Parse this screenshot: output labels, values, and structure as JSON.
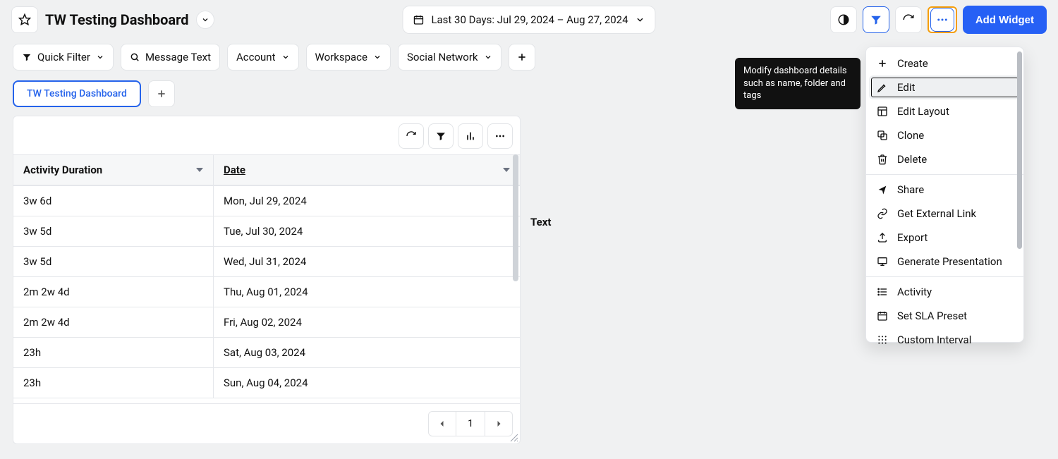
{
  "header": {
    "title": "TW Testing Dashboard",
    "date_label": "Last 30 Days: Jul 29, 2024 – Aug 27, 2024",
    "add_widget_label": "Add Widget"
  },
  "filters": {
    "quick_filter": "Quick Filter",
    "message_text": "Message Text",
    "account": "Account",
    "workspace": "Workspace",
    "social_network": "Social Network"
  },
  "tabs": {
    "active": "TW Testing Dashboard"
  },
  "tooltip": "Modify dashboard details such as name, folder and tags",
  "menu": {
    "create": "Create",
    "edit": "Edit",
    "edit_layout": "Edit Layout",
    "clone": "Clone",
    "delete": "Delete",
    "share": "Share",
    "external_link": "Get External Link",
    "export": "Export",
    "generate_presentation": "Generate Presentation",
    "activity": "Activity",
    "sla_preset": "Set SLA Preset",
    "custom_interval": "Custom Interval"
  },
  "widget": {
    "columns": {
      "activity": "Activity Duration",
      "date": "Date"
    },
    "rows": [
      {
        "activity": "3w 6d",
        "date": "Mon, Jul 29, 2024"
      },
      {
        "activity": "3w 5d",
        "date": "Tue, Jul 30, 2024"
      },
      {
        "activity": "3w 5d",
        "date": "Wed, Jul 31, 2024"
      },
      {
        "activity": "2m 2w 4d",
        "date": "Thu, Aug 01, 2024"
      },
      {
        "activity": "2m 2w 4d",
        "date": "Fri, Aug 02, 2024"
      },
      {
        "activity": "23h",
        "date": "Sat, Aug 03, 2024"
      },
      {
        "activity": "23h",
        "date": "Sun, Aug 04, 2024"
      }
    ],
    "pager": {
      "page": "1"
    }
  },
  "side_widget_label": "Text"
}
